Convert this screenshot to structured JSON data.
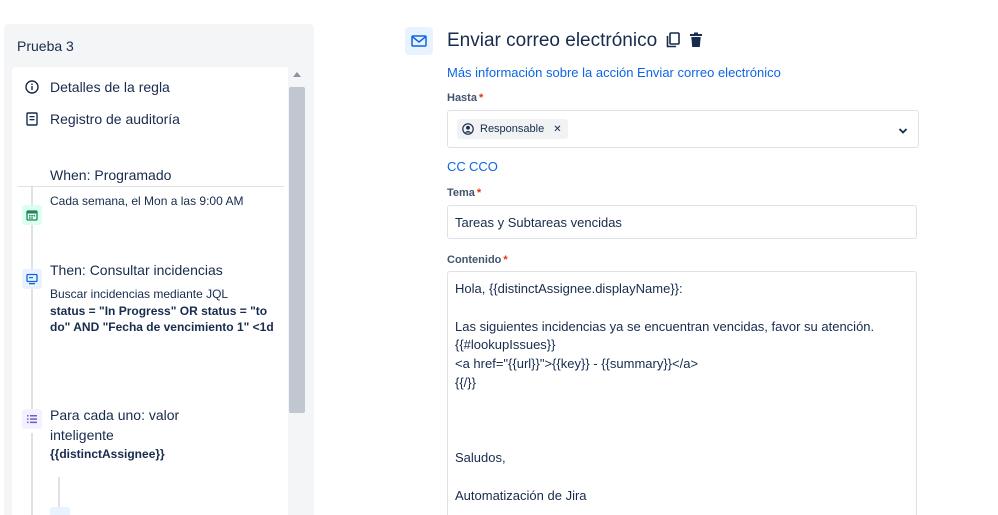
{
  "sidebar": {
    "rule_name": "Prueba 3",
    "menu": [
      {
        "label": "Detalles de la regla",
        "icon": "info-icon"
      },
      {
        "label": "Registro de auditoría",
        "icon": "audit-log-icon"
      }
    ],
    "steps": [
      {
        "title": "When: Programado",
        "subtitle": "Cada semana, el Mon a las 9:00 AM",
        "icon": "calendar-icon",
        "color": "#1f845a"
      },
      {
        "title": "Then: Consultar incidencias",
        "subtitle": "Buscar incidencias mediante JQL",
        "bold_text": "status = \"In Progress\" OR status = \"to do\" AND \"Fecha de vencimiento 1\" <1d",
        "icon": "monitor-icon",
        "color": "#0c66e4"
      },
      {
        "title_line1": "Para cada uno: valor",
        "title_line2": "inteligente",
        "bold_text": "{{distinctAssignee}}",
        "icon": "list-icon",
        "color": "#6e5dc6"
      }
    ]
  },
  "action": {
    "title": "Enviar correo electrónico",
    "more_info_link": "Más información sobre la acción Enviar correo electrónico",
    "to_label": "Hasta",
    "to_chip": "Responsable",
    "cc_label": "CC",
    "bcc_label": "CCO",
    "subject_label": "Tema",
    "subject_value": "Tareas y Subtareas vencidas",
    "content_label": "Contenido",
    "required_mark": "*",
    "content_lines": [
      "Hola, {{distinctAssignee.displayName}}:",
      "",
      "Las siguientes incidencias ya se encuentran vencidas, favor su atención.",
      "{{#lookupIssues}}",
      "<a href=\"{{url}}\">{{key}} - {{summary}}</a>",
      "{{/}}",
      "",
      "",
      "",
      "Saludos,",
      "",
      "Automatización de Jira"
    ]
  },
  "colors": {
    "link": "#0c66e4",
    "required": "#de350b",
    "accent_bg": "#e9f2ff"
  }
}
